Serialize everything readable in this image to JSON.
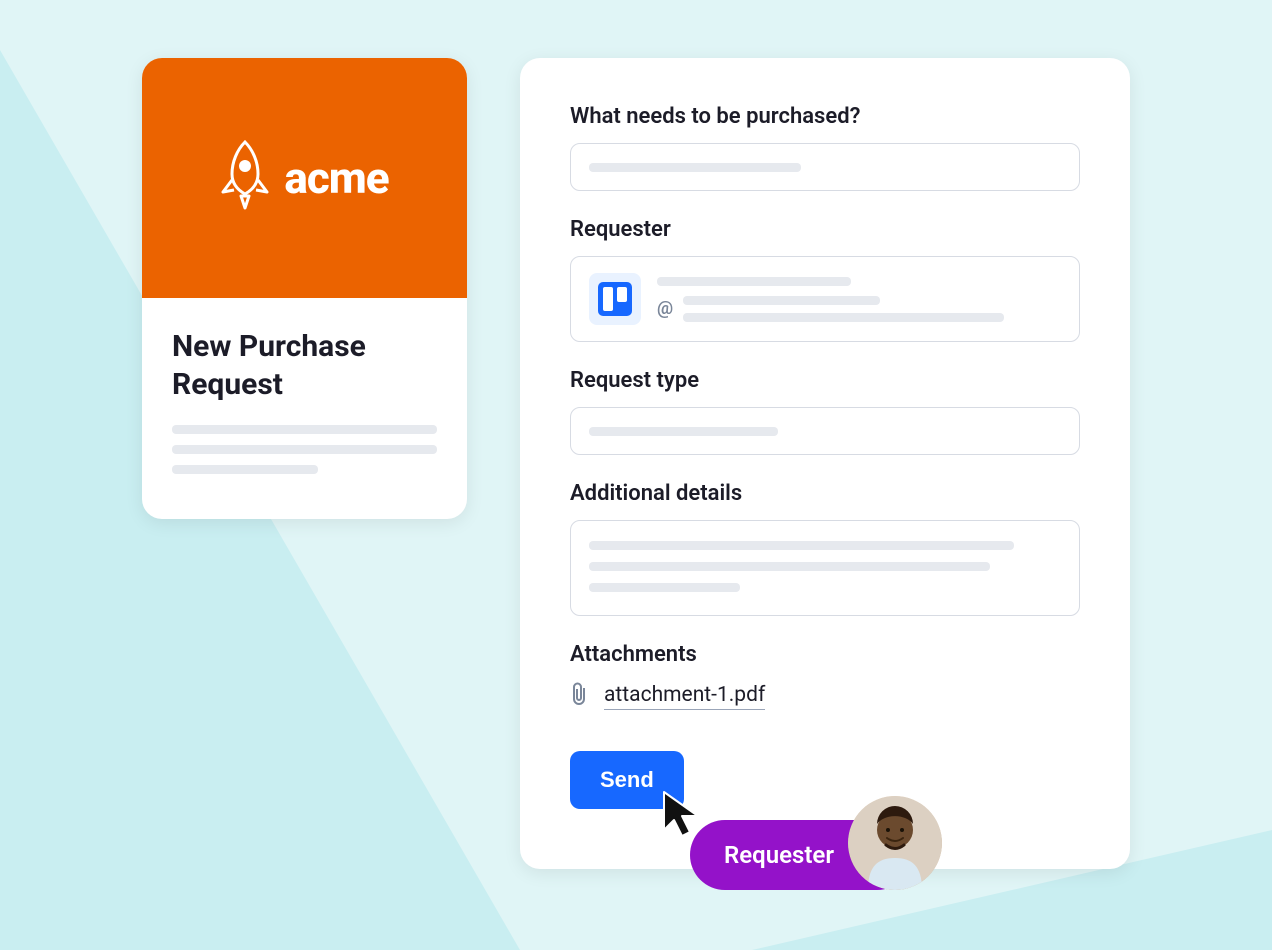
{
  "brand": {
    "name": "acme",
    "color": "#eb6300"
  },
  "preview": {
    "title": "New Purchase Request"
  },
  "form": {
    "fields": {
      "purchase": {
        "label": "What needs to be purchased?"
      },
      "requester": {
        "label": "Requester",
        "at": "@"
      },
      "request_type": {
        "label": "Request type"
      },
      "details": {
        "label": "Additional details"
      },
      "attachments": {
        "label": "Attachments",
        "file": "attachment-1.pdf"
      }
    },
    "submit_label": "Send"
  },
  "role_badge": {
    "label": "Requester"
  }
}
